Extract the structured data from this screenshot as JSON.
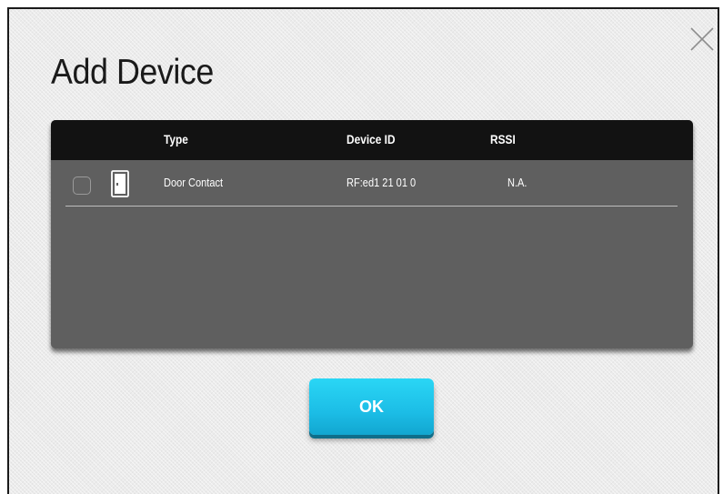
{
  "dialog": {
    "title": "Add Device",
    "close_icon": "close-icon"
  },
  "table": {
    "columns": [
      "Type",
      "Device ID",
      "RSSI"
    ],
    "rows": [
      {
        "checked": false,
        "icon": "door-icon",
        "type": "Door Contact",
        "device_id": "RF:ed1 21 01 0",
        "rssi": "N.A."
      }
    ]
  },
  "actions": {
    "ok_label": "OK"
  },
  "colors": {
    "header_bg": "#121212",
    "table_bg": "#5f5f5f",
    "ok_button": "#1cbde6"
  }
}
